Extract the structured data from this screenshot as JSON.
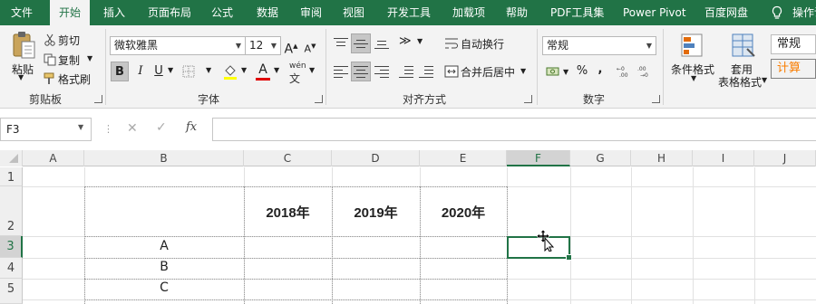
{
  "tabs": [
    {
      "label": "文件"
    },
    {
      "label": "开始"
    },
    {
      "label": "插入"
    },
    {
      "label": "页面布局"
    },
    {
      "label": "公式"
    },
    {
      "label": "数据"
    },
    {
      "label": "审阅"
    },
    {
      "label": "视图"
    },
    {
      "label": "开发工具"
    },
    {
      "label": "加载项"
    },
    {
      "label": "帮助"
    },
    {
      "label": "PDF工具集"
    },
    {
      "label": "Power Pivot"
    },
    {
      "label": "百度网盘"
    },
    {
      "label": "操作说"
    }
  ],
  "clipboard": {
    "paste": "粘贴",
    "cut": "剪切",
    "copy": "复制",
    "format_painter": "格式刷",
    "group_label": "剪贴板"
  },
  "font": {
    "name": "微软雅黑",
    "size": "12",
    "group_label": "字体",
    "bold": "B",
    "italic": "I",
    "underline": "U",
    "grow": "A",
    "shrink": "A",
    "color_a": "A",
    "wen": "wén",
    "wen_char": "文"
  },
  "alignment": {
    "wrap": "自动换行",
    "merge": "合并后居中",
    "group_label": "对齐方式"
  },
  "number": {
    "format": "常规",
    "percent": "%",
    "comma": ",",
    "group_label": "数字"
  },
  "styles": {
    "conditional": "条件格式",
    "table_format_line1": "套用",
    "table_format_line2": "表格格式",
    "normal": "常规",
    "calc": "计算"
  },
  "formula_bar": {
    "name_box": "F3",
    "fx": "fx",
    "formula": ""
  },
  "columns": [
    "A",
    "B",
    "C",
    "D",
    "E",
    "F",
    "G",
    "H",
    "I",
    "J"
  ],
  "rows": [
    "1",
    "2",
    "3",
    "4",
    "5"
  ],
  "table": {
    "headers": [
      "2018年",
      "2019年",
      "2020年"
    ],
    "row_labels": [
      "A",
      "B",
      "C"
    ]
  },
  "colors": {
    "accent": "#217346",
    "ribbon_bg": "#f3f3f3",
    "style_normal_bg": "#ffffff",
    "style_calc_bg": "#f2f2f2",
    "style_calc_text": "#fa7d00"
  },
  "selected_cell": "F3"
}
